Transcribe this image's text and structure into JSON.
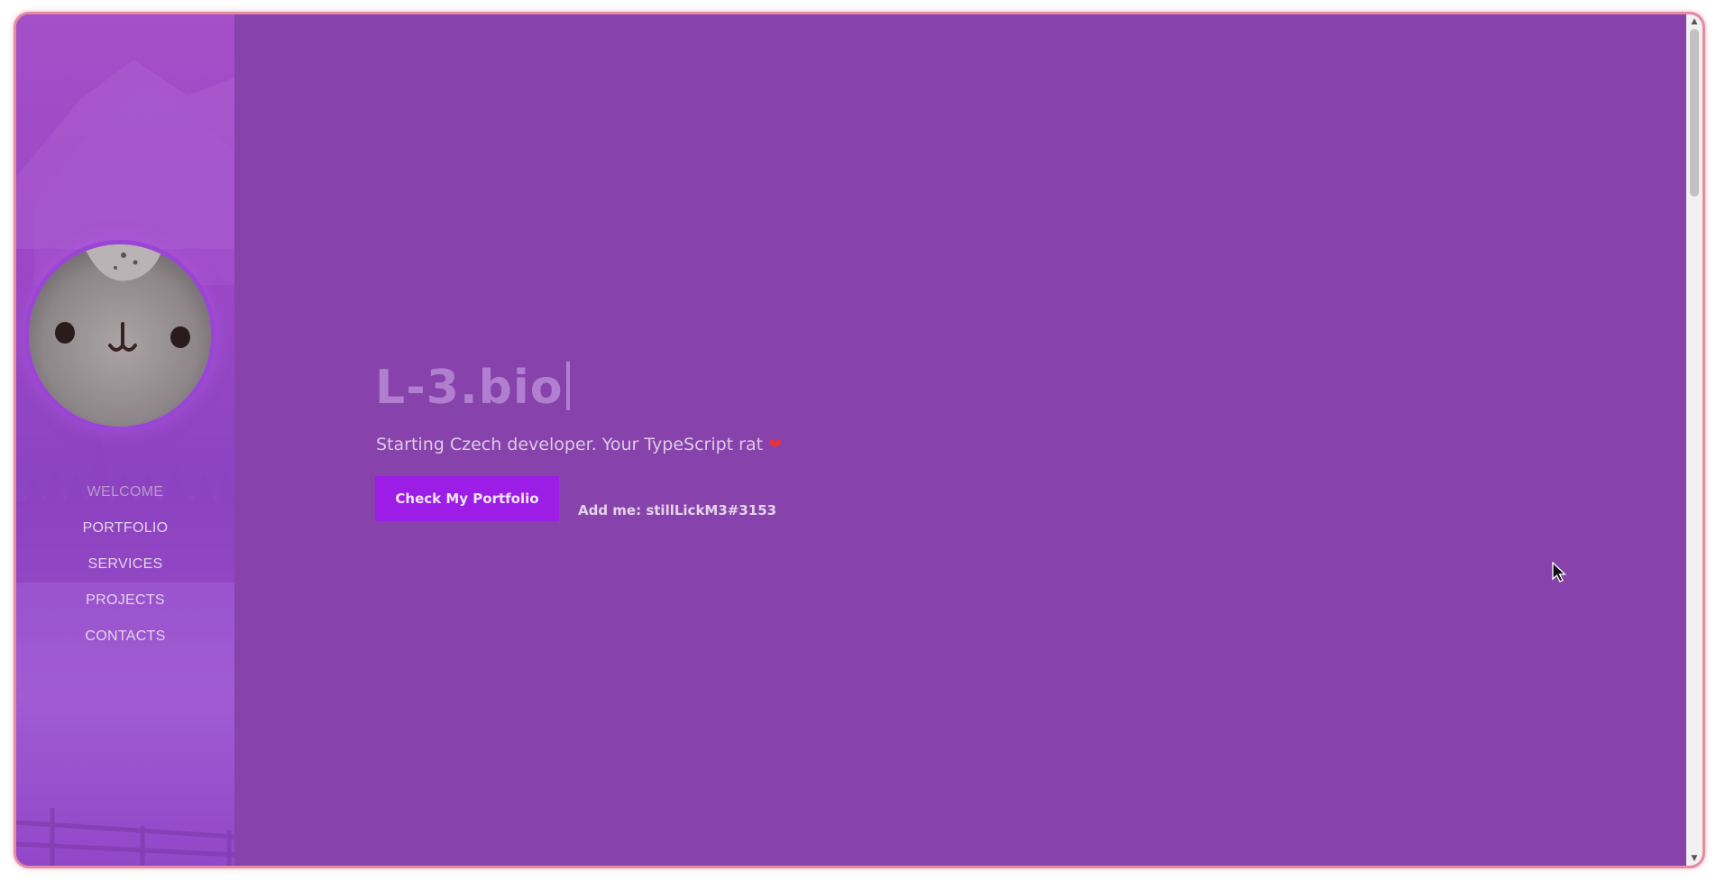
{
  "sidebar": {
    "avatar_icon": "plush-bunny-avatar",
    "nav": [
      {
        "label": "WELCOME",
        "active": true
      },
      {
        "label": "PORTFOLIO",
        "active": false
      },
      {
        "label": "SERVICES",
        "active": false
      },
      {
        "label": "PROJECTS",
        "active": false
      },
      {
        "label": "CONTACTS",
        "active": false
      }
    ]
  },
  "hero": {
    "title": "L-3.bio",
    "subtitle": "Starting Czech developer. Your TypeScript rat",
    "heart": "❤",
    "cta_label": "Check My Portfolio",
    "discord_label": "Add me: stillLickM3#3153"
  },
  "colors": {
    "background": "#8743ab",
    "accent_button": "#9b1de6",
    "frame_border": "#e58aa3"
  },
  "icons": [
    "scroll-up-arrow-icon",
    "scroll-down-arrow-icon",
    "heart-icon",
    "mouse-cursor-icon"
  ]
}
